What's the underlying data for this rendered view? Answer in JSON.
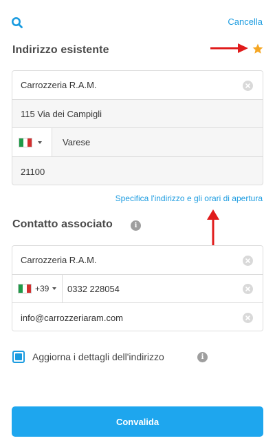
{
  "header": {
    "cancel_label": "Cancella"
  },
  "address_section": {
    "title": "Indirizzo esistente",
    "company": "Carrozzeria R.A.M.",
    "street": "115 Via dei Campigli",
    "country_flag": "IT",
    "city": "Varese",
    "postal_code": "21100",
    "specify_link": "Specifica l'indirizzo e gli orari di apertura"
  },
  "contact_section": {
    "title": "Contatto associato",
    "name": "Carrozzeria R.A.M.",
    "phone_prefix": "+39",
    "phone_number": "0332 228054",
    "email": "info@carrozzeriaram.com"
  },
  "update_checkbox": {
    "label": "Aggiorna i dettagli dell'indirizzo",
    "checked": true
  },
  "submit": {
    "label": "Convalida"
  },
  "colors": {
    "accent": "#1ea6ee",
    "link": "#1a9be0",
    "star": "#f5a623",
    "annotation_arrow": "#e01b1b"
  },
  "icons": [
    "search-icon",
    "star-icon",
    "clear-icon",
    "info-icon",
    "italy-flag-icon",
    "chevron-down-icon",
    "annotation-arrow"
  ]
}
